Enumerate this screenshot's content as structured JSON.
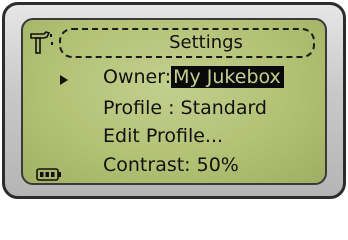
{
  "screen": {
    "title": "Settings",
    "menu": [
      {
        "label": "Owner:",
        "value": "My Jukebox",
        "selected": true
      },
      {
        "label": "Profile : Standard"
      },
      {
        "label": "Edit Profile..."
      },
      {
        "label": "Contrast: 50%"
      }
    ]
  },
  "icons": {
    "header": "hammer-icon",
    "selection": "arrow-icon",
    "status": "battery-icon"
  },
  "colors": {
    "lcd_background": "#b3c175",
    "text": "#111111",
    "highlight": "#0a0a0a"
  }
}
